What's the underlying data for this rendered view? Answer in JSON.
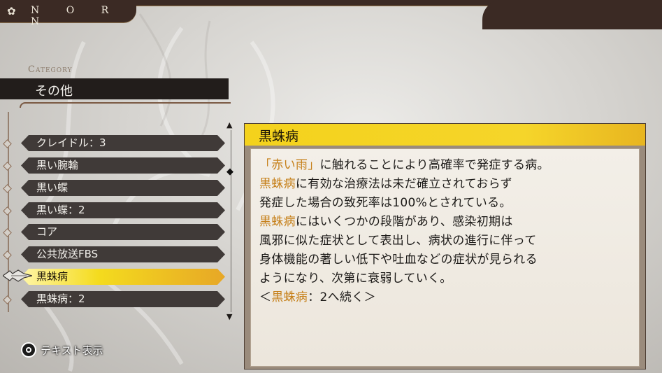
{
  "brand": {
    "title": "N O R N"
  },
  "category": {
    "label": "Category",
    "value": "その他"
  },
  "list": {
    "items": [
      {
        "label": "クレイドル：3"
      },
      {
        "label": "黒い腕輪"
      },
      {
        "label": "黒い蝶"
      },
      {
        "label": "黒い蝶：2"
      },
      {
        "label": "コア"
      },
      {
        "label": "公共放送FBS"
      },
      {
        "label": "黒蛛病",
        "selected": true
      },
      {
        "label": "黒蛛病：2"
      }
    ]
  },
  "detail": {
    "title": "黒蛛病",
    "lines": [
      {
        "a": "「赤い雨」",
        "b": "に触れることにより高確率で発症する病。"
      },
      {
        "a": "黒蛛病",
        "b": "に有効な治療法は未だ確立されておらず"
      },
      {
        "a": "",
        "b": "発症した場合の致死率は100%とされている。"
      },
      {
        "a": "黒蛛病",
        "b": "にはいくつかの段階があり、感染初期は"
      },
      {
        "a": "",
        "b": "風邪に似た症状として表出し、病状の進行に伴って"
      },
      {
        "a": "",
        "b": "身体機能の著しい低下や吐血などの症状が見られる"
      },
      {
        "a": "",
        "b": "ようになり、次第に衰弱していく。"
      },
      {
        "pre": "＜",
        "a": "黒蛛病",
        "b": "：2へ続く＞"
      }
    ]
  },
  "footer": {
    "button_icon": "circle-button-icon",
    "label": "テキスト表示"
  },
  "colors": {
    "accent_yellow": "#f4d21c",
    "highlight_orange": "#c6801a",
    "frame_brown": "#3b2a24"
  }
}
